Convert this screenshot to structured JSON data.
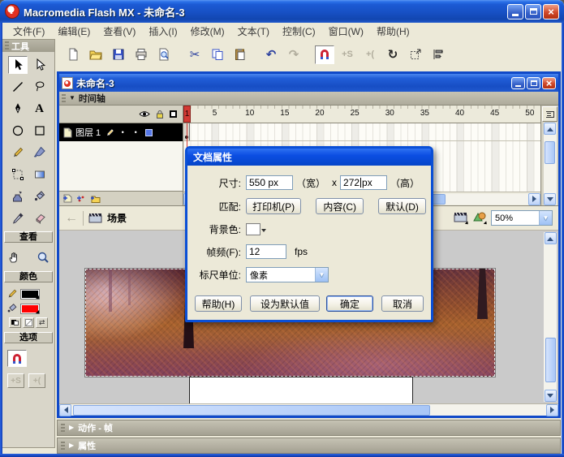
{
  "app": {
    "title": "Macromedia Flash MX - 未命名-3"
  },
  "glyphs": {
    "undo": "↶",
    "redo": "↷",
    "rotate": "↻",
    "cut": "✂",
    "smooth": "+S",
    "straighten": "+(",
    "back_arrow": "←",
    "expand": "▶",
    "collapse": "▼",
    "dropdown": "▼",
    "text_tool": "A",
    "close": "×",
    "swap": "⇄",
    "dot": "•"
  },
  "menu": {
    "items": [
      "文件(F)",
      "编辑(E)",
      "查看(V)",
      "插入(I)",
      "修改(M)",
      "文本(T)",
      "控制(C)",
      "窗口(W)",
      "帮助(H)"
    ]
  },
  "toolbar": {
    "buttons": [
      "new",
      "open",
      "save",
      "print",
      "print-preview",
      "cut",
      "copy",
      "paste",
      "undo",
      "redo",
      "snap",
      "smooth",
      "straighten",
      "rotate",
      "scale",
      "align"
    ]
  },
  "tools_panel": {
    "title": "工具",
    "view_title": "查看",
    "colors_title": "颜色",
    "options_title": "选项",
    "tool_names": [
      "arrow",
      "subselect",
      "line",
      "lasso",
      "pen",
      "text",
      "oval",
      "rectangle",
      "pencil",
      "brush",
      "free-transform",
      "fill-transform",
      "ink-bottle",
      "paint-bucket",
      "eyedropper",
      "eraser",
      "hand",
      "zoom"
    ],
    "stroke_color": "#000000",
    "fill_color": "#ff0000"
  },
  "doc": {
    "title": "未命名-3",
    "timeline_title": "时间轴",
    "layer_name": "图层 1",
    "playhead_frame": "1",
    "ruler_ticks": [
      "5",
      "10",
      "15",
      "20",
      "25",
      "30",
      "35",
      "40",
      "45",
      "50"
    ],
    "scene_label": "场景",
    "zoom_value": "50%"
  },
  "dialog": {
    "title": "文档属性",
    "size_label": "尺寸:",
    "width_value": "550",
    "height_value": "272",
    "px_unit": "px",
    "width_caption": "（宽）",
    "times_label": "x",
    "height_caption": "（高）",
    "match_label": "匹配:",
    "printer_button": "打印机(P)",
    "contents_button": "内容(C)",
    "default_button": "默认(D)",
    "bg_label": "背景色:",
    "bg_color": "#ffffff",
    "fps_label": "帧频(F):",
    "fps_value": "12",
    "fps_unit": "fps",
    "ruler_units_label": "标尺单位:",
    "ruler_units_value": "像素",
    "help_button": "帮助(H)",
    "make_default_button": "设为默认值",
    "ok_button": "确定",
    "cancel_button": "取消"
  },
  "panels": {
    "actions_label": "动作 - 帧",
    "properties_label": "属性"
  },
  "colors": {
    "titlebar_blue": "#1750c4",
    "chrome": "#ece9d8",
    "playhead_red": "#d23a34",
    "layer_selected_bg": "#000000",
    "layer_outline_swatch": "#5577e8",
    "stage_workspace": "#cacaca"
  }
}
